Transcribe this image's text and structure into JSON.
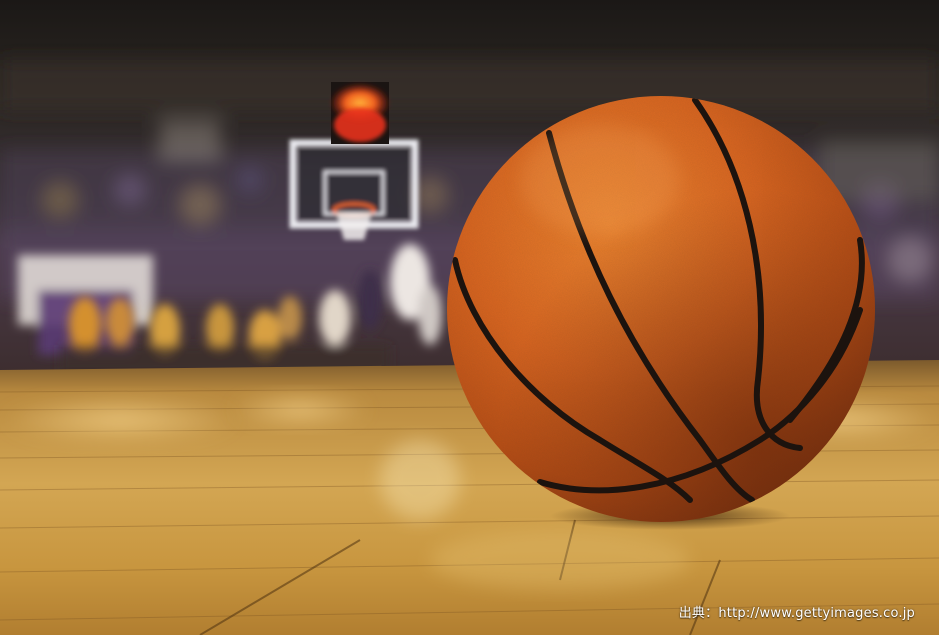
{
  "photo": {
    "subject": "basketball-on-court",
    "credit_text": "出典：http://www.gettyimages.co.jp"
  },
  "colors": {
    "ball_orange": "#d8641f",
    "ball_seam": "#1c130e",
    "floor_wood": "#c99a43",
    "arena_dark": "#1e1a18",
    "shot_clock_red": "#e8321a"
  }
}
